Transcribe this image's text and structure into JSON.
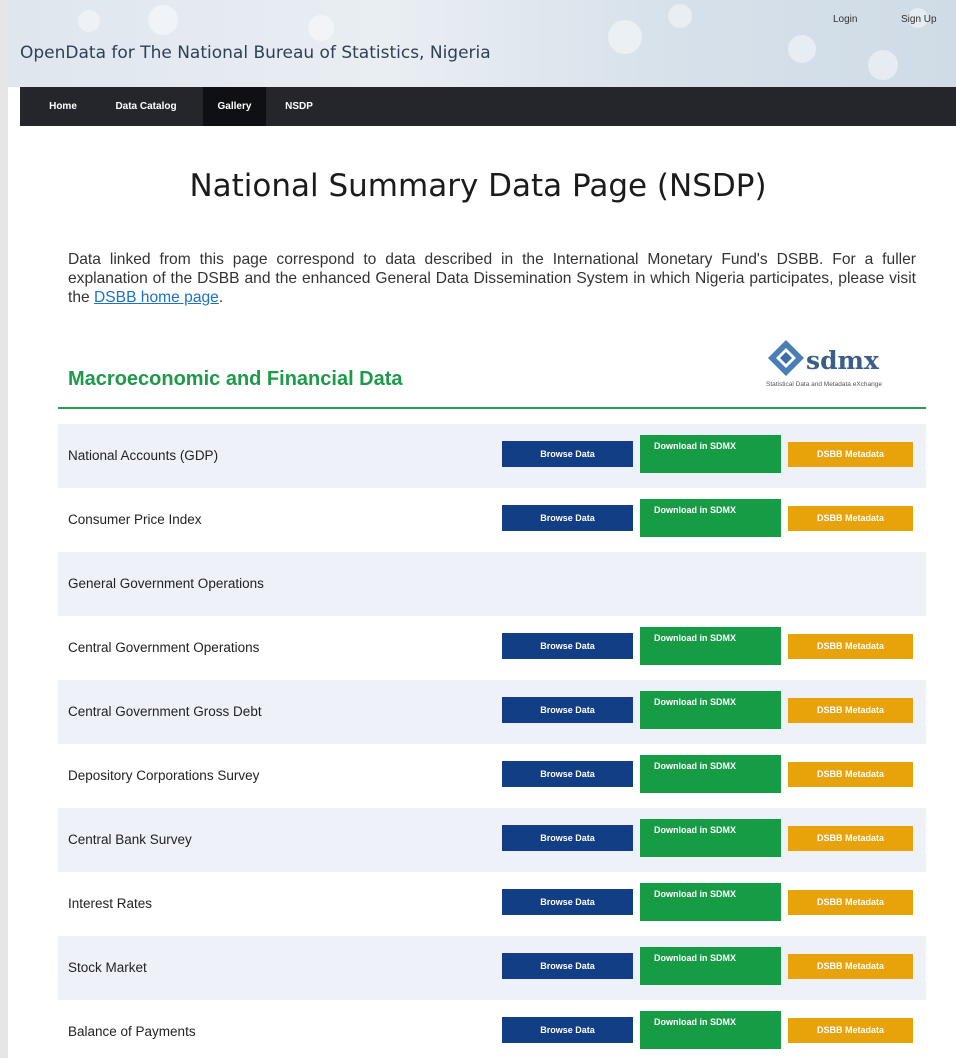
{
  "header": {
    "site_title": "OpenData for The National Bureau of Statistics, Nigeria",
    "login": "Login",
    "signup": "Sign Up"
  },
  "nav": {
    "items": [
      {
        "label": "Home"
      },
      {
        "label": "Data Catalog"
      },
      {
        "label": "Gallery",
        "active": true
      },
      {
        "label": "NSDP"
      }
    ]
  },
  "page": {
    "title": "National Summary Data Page (NSDP)",
    "intro_text": "Data linked from this page correspond to data described in the International Monetary Fund's DSBB. For a fuller explanation of the DSBB and the enhanced General Data Dissemination System in which Nigeria participates, please visit the ",
    "intro_link": "DSBB home page",
    "intro_end": "."
  },
  "section": {
    "heading": "Macroeconomic and Financial Data",
    "logo_text": "sdmx",
    "logo_sub": "Statistical Data and Metadata eXchange"
  },
  "buttons": {
    "browse": "Browse Data",
    "download": "Download in SDMX",
    "metadata": "DSBB Metadata"
  },
  "rows": [
    {
      "label": "National Accounts (GDP)",
      "has_buttons": true
    },
    {
      "label": "Consumer Price Index",
      "has_buttons": true
    },
    {
      "label": "General Government Operations",
      "has_buttons": false
    },
    {
      "label": "Central Government Operations",
      "has_buttons": true
    },
    {
      "label": "Central Government Gross Debt",
      "has_buttons": true
    },
    {
      "label": "Depository Corporations Survey",
      "has_buttons": true
    },
    {
      "label": "Central Bank Survey",
      "has_buttons": true
    },
    {
      "label": "Interest Rates",
      "has_buttons": true
    },
    {
      "label": "Stock Market",
      "has_buttons": true
    },
    {
      "label": "Balance of Payments",
      "has_buttons": true
    }
  ],
  "colors": {
    "nav_bg": "#24262c",
    "heading_green": "#1d9a4a",
    "browse_blue": "#123e86",
    "download_green": "#179c46",
    "metadata_orange": "#e9a30a",
    "row_alt": "#eef1f7"
  }
}
